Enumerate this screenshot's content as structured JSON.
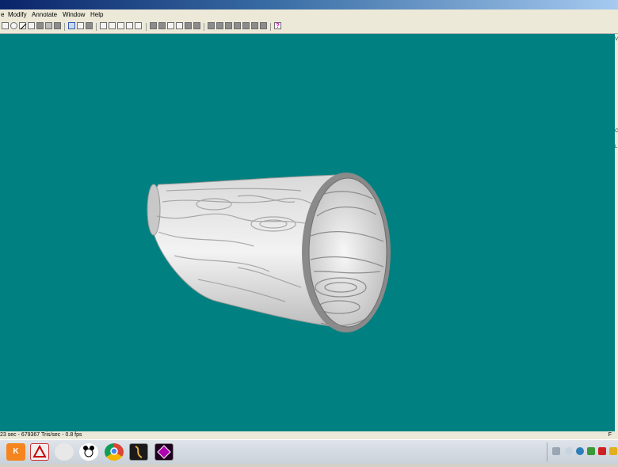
{
  "menu": [
    "e",
    "Modify",
    "Annotate",
    "Window",
    "Help"
  ],
  "toolbar": {
    "icons": [
      "rectangle-tool-icon",
      "ellipse-tool-icon",
      "line-tool-icon",
      "lasso-tool-icon",
      "pick-tool-icon",
      "zoom-tool-icon",
      "pan-tool-icon",
      "record-icon",
      "save-image-icon",
      "camera-icon",
      "first-frame-icon",
      "prev-frame-icon",
      "play-icon",
      "next-frame-icon",
      "last-frame-icon"
    ],
    "help_label": "?"
  },
  "viewport": {
    "background": "#008080",
    "object": "wood-grain-cone-surface"
  },
  "right_panel": {
    "marks": [
      "V",
      "C",
      "L"
    ]
  },
  "status": {
    "text": "23 sec - 679367 Tris/sec - 0.8 fps",
    "right": "F"
  },
  "taskbar": {
    "apps": [
      "kt-app-icon",
      "acrobat-icon",
      "orb-app-icon",
      "panda-icon",
      "chrome-icon",
      "game-app-icon",
      "diamond-app-icon"
    ]
  }
}
